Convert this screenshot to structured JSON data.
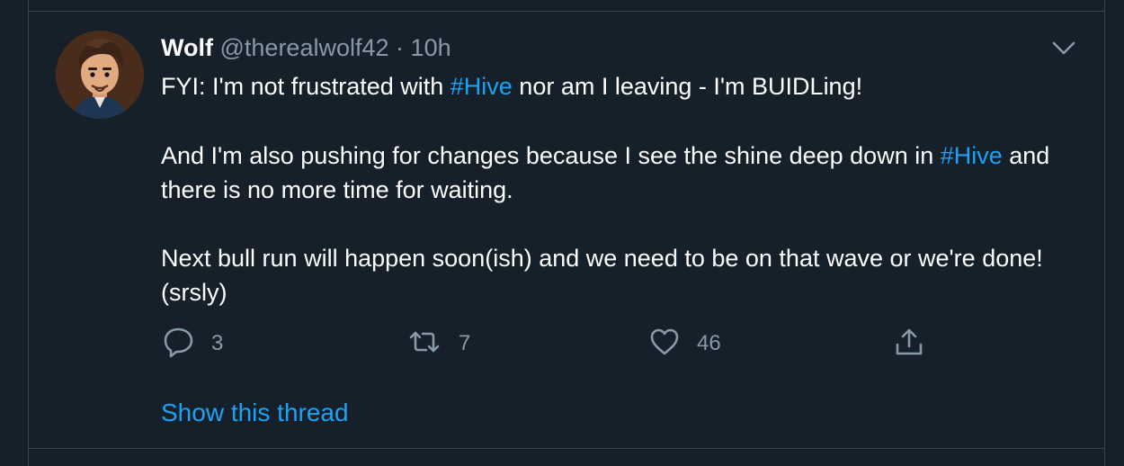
{
  "tweet": {
    "author_name": "Wolf",
    "author_handle": "@therealwolf42",
    "separator": "·",
    "time": "10h",
    "para1": {
      "before": "FYI: I'm not frustrated with ",
      "hashtag": "#Hive",
      "after": " nor am I leaving - I'm BUIDLing!"
    },
    "para2": {
      "before": "And I'm also pushing for changes because I see the shine deep down in ",
      "hashtag": "#Hive",
      "after": " and there is no more time for waiting."
    },
    "para3": "Next bull run will happen soon(ish) and we need to be on that wave or we're done! (srsly)",
    "actions": {
      "reply_icon": "reply-icon",
      "reply_count": "3",
      "retweet_icon": "retweet-icon",
      "retweet_count": "7",
      "like_icon": "heart-icon",
      "like_count": "46",
      "share_icon": "share-icon"
    },
    "show_thread": "Show this thread"
  },
  "colors": {
    "background": "#15202b",
    "border": "#38444d",
    "text": "#ffffff",
    "muted": "#8899a6",
    "accent": "#1da1f2"
  }
}
